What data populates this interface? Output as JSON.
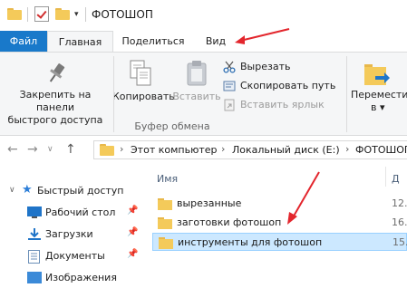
{
  "window": {
    "title": "ФОТОШОП"
  },
  "tabs": {
    "file": "Файл",
    "home": "Главная",
    "share": "Поделиться",
    "view": "Вид"
  },
  "ribbon": {
    "pin_label": "Закрепить на панели быстрого доступа",
    "pin_line1": "Закрепить на панели",
    "pin_line2": "быстрого доступа",
    "copy": "Копировать",
    "paste": "Вставить",
    "cut": "Вырезать",
    "copy_path": "Скопировать путь",
    "paste_shortcut": "Вставить ярлык",
    "group_clipboard": "Буфер обмена",
    "move_line1": "Переместить",
    "move_line2": "в"
  },
  "address": {
    "crumbs": [
      "Этот компьютер",
      "Локальный диск (E:)",
      "ФОТОШОП"
    ]
  },
  "nav": {
    "items": [
      {
        "label": "Быстрый доступ",
        "icon": "star-icon"
      },
      {
        "label": "Рабочий стол",
        "icon": "desktop-icon"
      },
      {
        "label": "Загрузки",
        "icon": "download-icon"
      },
      {
        "label": "Документы",
        "icon": "documents-icon"
      },
      {
        "label": "Изображения",
        "icon": "pictures-icon"
      }
    ]
  },
  "content": {
    "column_name": "Имя",
    "column_date": "Д",
    "files": [
      {
        "name": "вырезанные",
        "date": "12."
      },
      {
        "name": "заготовки фотошоп",
        "date": "16."
      },
      {
        "name": "инструменты для фотошоп",
        "date": "15."
      }
    ]
  },
  "colors": {
    "accent": "#1979ca",
    "selection": "#cce8ff",
    "arrow": "#e3262d"
  }
}
